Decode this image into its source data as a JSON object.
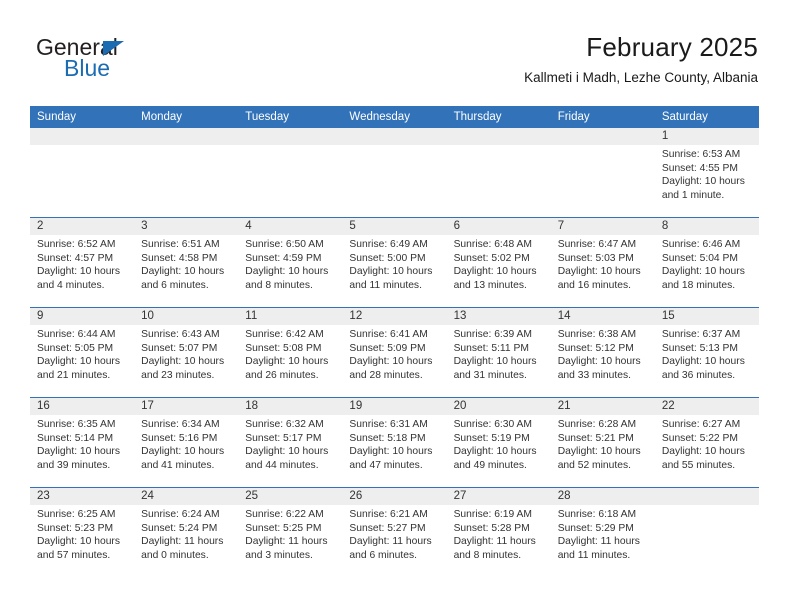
{
  "brand": {
    "name_part1": "General",
    "name_part2": "Blue",
    "accent_color": "#1b6cb3",
    "triangle_icon": "brand-triangle-icon"
  },
  "header": {
    "title": "February 2025",
    "subtitle": "Kallmeti i Madh, Lezhe County, Albania"
  },
  "calendar": {
    "header_bg": "#3172b9",
    "header_text_color": "#ffffff",
    "daynum_band_bg": "#eeeeee",
    "row_separator_color": "#3172b9",
    "weekday_labels": [
      "Sunday",
      "Monday",
      "Tuesday",
      "Wednesday",
      "Thursday",
      "Friday",
      "Saturday"
    ],
    "weeks": [
      [
        {
          "day": "",
          "sunrise": "",
          "sunset": "",
          "daylight": ""
        },
        {
          "day": "",
          "sunrise": "",
          "sunset": "",
          "daylight": ""
        },
        {
          "day": "",
          "sunrise": "",
          "sunset": "",
          "daylight": ""
        },
        {
          "day": "",
          "sunrise": "",
          "sunset": "",
          "daylight": ""
        },
        {
          "day": "",
          "sunrise": "",
          "sunset": "",
          "daylight": ""
        },
        {
          "day": "",
          "sunrise": "",
          "sunset": "",
          "daylight": ""
        },
        {
          "day": "1",
          "sunrise": "Sunrise: 6:53 AM",
          "sunset": "Sunset: 4:55 PM",
          "daylight": "Daylight: 10 hours and 1 minute."
        }
      ],
      [
        {
          "day": "2",
          "sunrise": "Sunrise: 6:52 AM",
          "sunset": "Sunset: 4:57 PM",
          "daylight": "Daylight: 10 hours and 4 minutes."
        },
        {
          "day": "3",
          "sunrise": "Sunrise: 6:51 AM",
          "sunset": "Sunset: 4:58 PM",
          "daylight": "Daylight: 10 hours and 6 minutes."
        },
        {
          "day": "4",
          "sunrise": "Sunrise: 6:50 AM",
          "sunset": "Sunset: 4:59 PM",
          "daylight": "Daylight: 10 hours and 8 minutes."
        },
        {
          "day": "5",
          "sunrise": "Sunrise: 6:49 AM",
          "sunset": "Sunset: 5:00 PM",
          "daylight": "Daylight: 10 hours and 11 minutes."
        },
        {
          "day": "6",
          "sunrise": "Sunrise: 6:48 AM",
          "sunset": "Sunset: 5:02 PM",
          "daylight": "Daylight: 10 hours and 13 minutes."
        },
        {
          "day": "7",
          "sunrise": "Sunrise: 6:47 AM",
          "sunset": "Sunset: 5:03 PM",
          "daylight": "Daylight: 10 hours and 16 minutes."
        },
        {
          "day": "8",
          "sunrise": "Sunrise: 6:46 AM",
          "sunset": "Sunset: 5:04 PM",
          "daylight": "Daylight: 10 hours and 18 minutes."
        }
      ],
      [
        {
          "day": "9",
          "sunrise": "Sunrise: 6:44 AM",
          "sunset": "Sunset: 5:05 PM",
          "daylight": "Daylight: 10 hours and 21 minutes."
        },
        {
          "day": "10",
          "sunrise": "Sunrise: 6:43 AM",
          "sunset": "Sunset: 5:07 PM",
          "daylight": "Daylight: 10 hours and 23 minutes."
        },
        {
          "day": "11",
          "sunrise": "Sunrise: 6:42 AM",
          "sunset": "Sunset: 5:08 PM",
          "daylight": "Daylight: 10 hours and 26 minutes."
        },
        {
          "day": "12",
          "sunrise": "Sunrise: 6:41 AM",
          "sunset": "Sunset: 5:09 PM",
          "daylight": "Daylight: 10 hours and 28 minutes."
        },
        {
          "day": "13",
          "sunrise": "Sunrise: 6:39 AM",
          "sunset": "Sunset: 5:11 PM",
          "daylight": "Daylight: 10 hours and 31 minutes."
        },
        {
          "day": "14",
          "sunrise": "Sunrise: 6:38 AM",
          "sunset": "Sunset: 5:12 PM",
          "daylight": "Daylight: 10 hours and 33 minutes."
        },
        {
          "day": "15",
          "sunrise": "Sunrise: 6:37 AM",
          "sunset": "Sunset: 5:13 PM",
          "daylight": "Daylight: 10 hours and 36 minutes."
        }
      ],
      [
        {
          "day": "16",
          "sunrise": "Sunrise: 6:35 AM",
          "sunset": "Sunset: 5:14 PM",
          "daylight": "Daylight: 10 hours and 39 minutes."
        },
        {
          "day": "17",
          "sunrise": "Sunrise: 6:34 AM",
          "sunset": "Sunset: 5:16 PM",
          "daylight": "Daylight: 10 hours and 41 minutes."
        },
        {
          "day": "18",
          "sunrise": "Sunrise: 6:32 AM",
          "sunset": "Sunset: 5:17 PM",
          "daylight": "Daylight: 10 hours and 44 minutes."
        },
        {
          "day": "19",
          "sunrise": "Sunrise: 6:31 AM",
          "sunset": "Sunset: 5:18 PM",
          "daylight": "Daylight: 10 hours and 47 minutes."
        },
        {
          "day": "20",
          "sunrise": "Sunrise: 6:30 AM",
          "sunset": "Sunset: 5:19 PM",
          "daylight": "Daylight: 10 hours and 49 minutes."
        },
        {
          "day": "21",
          "sunrise": "Sunrise: 6:28 AM",
          "sunset": "Sunset: 5:21 PM",
          "daylight": "Daylight: 10 hours and 52 minutes."
        },
        {
          "day": "22",
          "sunrise": "Sunrise: 6:27 AM",
          "sunset": "Sunset: 5:22 PM",
          "daylight": "Daylight: 10 hours and 55 minutes."
        }
      ],
      [
        {
          "day": "23",
          "sunrise": "Sunrise: 6:25 AM",
          "sunset": "Sunset: 5:23 PM",
          "daylight": "Daylight: 10 hours and 57 minutes."
        },
        {
          "day": "24",
          "sunrise": "Sunrise: 6:24 AM",
          "sunset": "Sunset: 5:24 PM",
          "daylight": "Daylight: 11 hours and 0 minutes."
        },
        {
          "day": "25",
          "sunrise": "Sunrise: 6:22 AM",
          "sunset": "Sunset: 5:25 PM",
          "daylight": "Daylight: 11 hours and 3 minutes."
        },
        {
          "day": "26",
          "sunrise": "Sunrise: 6:21 AM",
          "sunset": "Sunset: 5:27 PM",
          "daylight": "Daylight: 11 hours and 6 minutes."
        },
        {
          "day": "27",
          "sunrise": "Sunrise: 6:19 AM",
          "sunset": "Sunset: 5:28 PM",
          "daylight": "Daylight: 11 hours and 8 minutes."
        },
        {
          "day": "28",
          "sunrise": "Sunrise: 6:18 AM",
          "sunset": "Sunset: 5:29 PM",
          "daylight": "Daylight: 11 hours and 11 minutes."
        },
        {
          "day": "",
          "sunrise": "",
          "sunset": "",
          "daylight": ""
        }
      ]
    ]
  }
}
